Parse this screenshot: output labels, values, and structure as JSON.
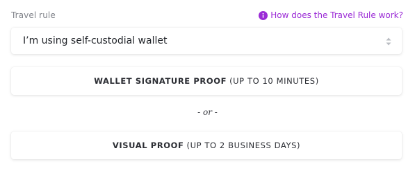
{
  "field": {
    "label": "Travel rule",
    "help_link": "How does the Travel Rule work?",
    "help_icon": "info-icon"
  },
  "select": {
    "value": "I’m using self-custodial wallet",
    "icon": "chevron-up-down-icon"
  },
  "buttons": {
    "wallet": {
      "title": "WALLET SIGNATURE PROOF",
      "detail": "(UP TO 10 MINUTES)"
    },
    "visual": {
      "title": "VISUAL PROOF",
      "detail": "(UP TO 2 BUSINESS DAYS)"
    }
  },
  "separator": "- or -",
  "colors": {
    "accent": "#9b2bd6",
    "label": "#80838a",
    "text": "#2b2d33"
  }
}
